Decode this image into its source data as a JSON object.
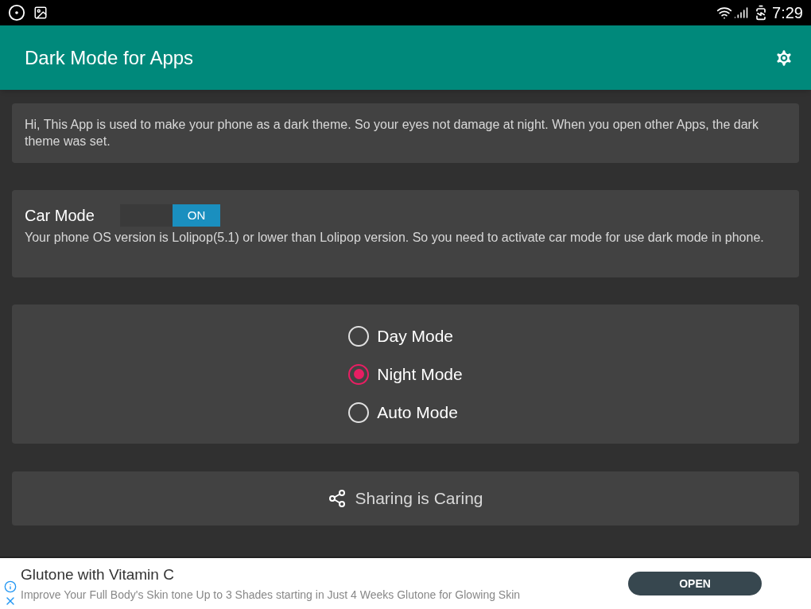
{
  "status_bar": {
    "time": "7:29"
  },
  "toolbar": {
    "title": "Dark Mode for Apps"
  },
  "intro": {
    "text": "Hi, This App is used to make your phone as a dark theme. So your eyes not damage at night. When you open other Apps, the dark theme was set."
  },
  "car_mode": {
    "label": "Car Mode",
    "toggle": {
      "on": true,
      "text": "ON"
    },
    "note": "Your phone OS version is Lolipop(5.1) or lower than Lolipop version. So you need to activate car mode for use dark mode in phone."
  },
  "modes": [
    {
      "label": "Day Mode",
      "selected": false
    },
    {
      "label": "Night Mode",
      "selected": true
    },
    {
      "label": "Auto Mode",
      "selected": false
    }
  ],
  "share_button": {
    "label": "Sharing is Caring"
  },
  "ad": {
    "title": "Glutone with Vitamin C",
    "text": "Improve Your Full Body's Skin tone Up to 3 Shades starting in Just 4 Weeks Glutone for Glowing Skin",
    "button": "OPEN"
  }
}
